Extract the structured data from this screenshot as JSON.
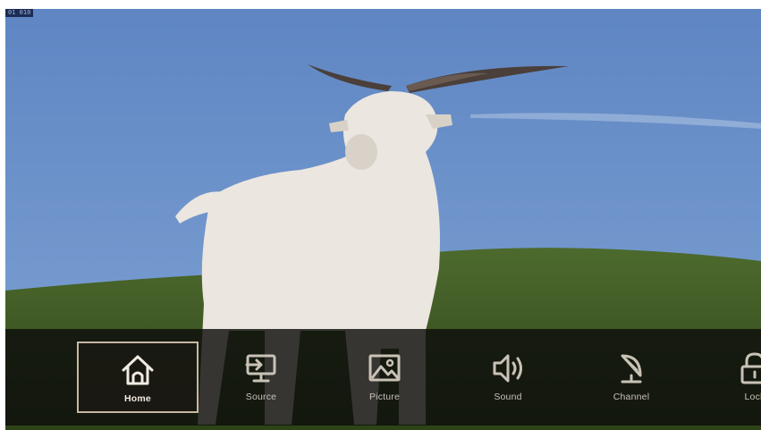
{
  "screen": {
    "badge_text": "01 010",
    "colors": {
      "sky_top": "#5e86c4",
      "sky_bottom": "#7a9ed2",
      "hill": "#3f5a24",
      "goat": "#ece8e2",
      "menu_bg": "#0e0e0c",
      "accent_border": "#c7b7a2"
    }
  },
  "menu": {
    "selected": "Home",
    "items": [
      {
        "label": "Home",
        "icon": "home-icon"
      },
      {
        "label": "Source",
        "icon": "source-input-icon"
      },
      {
        "label": "Picture",
        "icon": "picture-icon"
      },
      {
        "label": "Sound",
        "icon": "speaker-icon"
      },
      {
        "label": "Channel",
        "icon": "satellite-dish-icon"
      },
      {
        "label": "Lock",
        "icon": "lock-icon"
      }
    ]
  }
}
